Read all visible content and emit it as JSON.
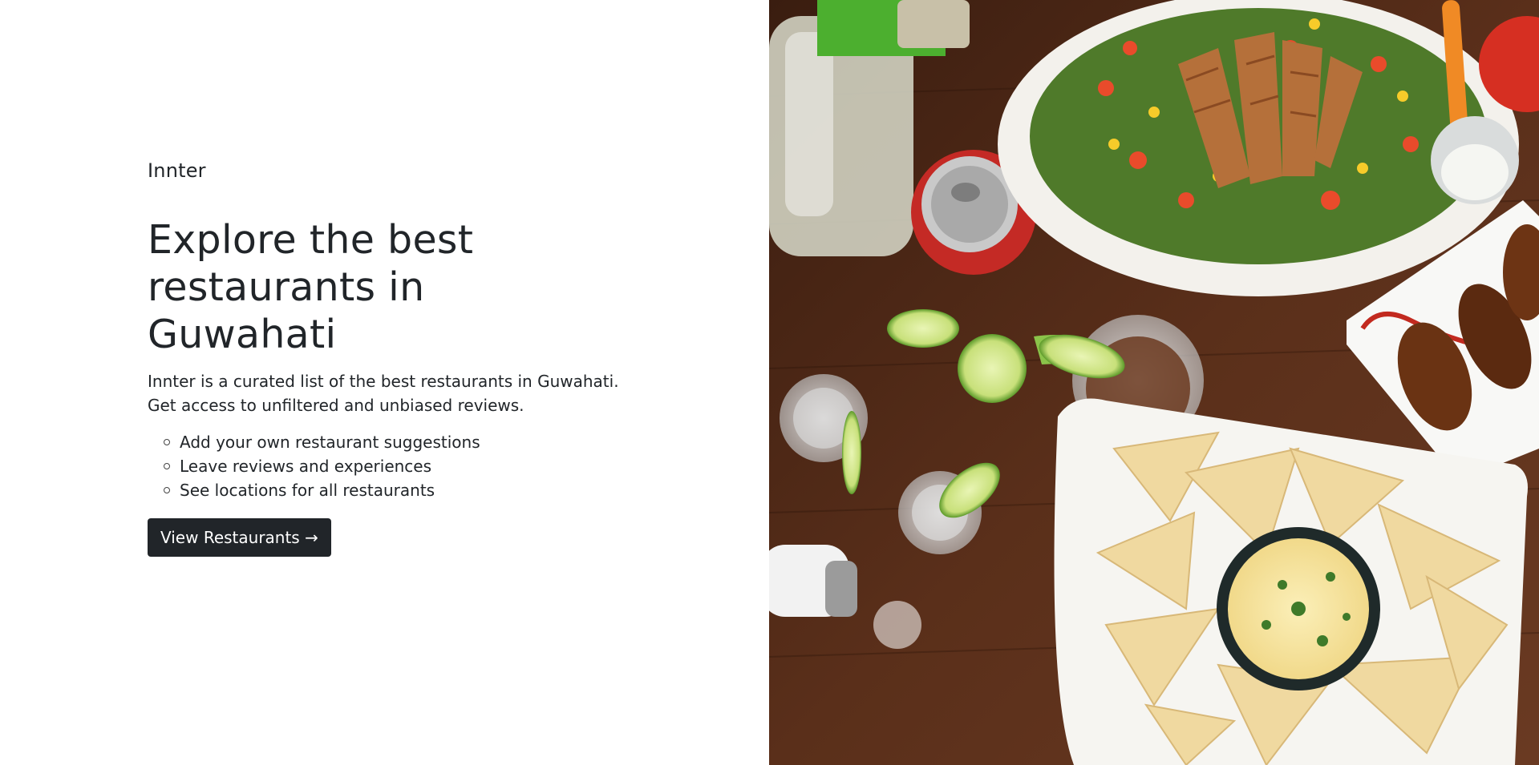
{
  "hero": {
    "brand": "Innter",
    "headline": "Explore the best restaurants in Guwahati",
    "lead": "Innter is a curated list of the best restaurants in Guwahati. Get access to unfiltered and unbiased reviews.",
    "features": [
      "Add your own restaurant suggestions",
      "Leave reviews and experiences",
      "See locations for all restaurants"
    ],
    "cta_label": "View Restaurants →"
  },
  "colors": {
    "text": "#212529",
    "button_bg": "#212529",
    "button_text": "#ffffff",
    "page_bg": "#ffffff",
    "table_wood": "#4a2616"
  }
}
